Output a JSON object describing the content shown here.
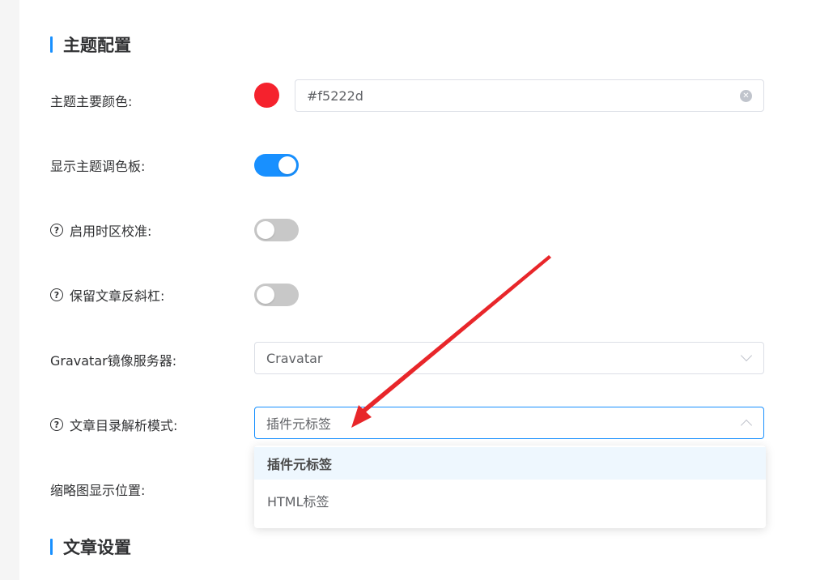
{
  "sections": {
    "theme_title": "主题配置",
    "article_title": "文章设置"
  },
  "rows": {
    "primary_color_label": "主题主要颜色:",
    "primary_color_value": "#f5222d",
    "show_palette_label": "显示主题调色板:",
    "show_palette_on": true,
    "timezone_label": "启用时区校准:",
    "timezone_on": false,
    "backslash_label": "保留文章反斜杠:",
    "backslash_on": false,
    "gravatar_label": "Gravatar镜像服务器:",
    "gravatar_value": "Cravatar",
    "toc_label": "文章目录解析模式:",
    "toc_value": "插件元标签",
    "thumbnail_label": "缩略图显示位置:"
  },
  "dropdown": {
    "options": [
      "插件元标签",
      "HTML标签"
    ],
    "selected": "插件元标签"
  },
  "icons": {
    "help": "question-circle-icon",
    "clear": "clear-icon",
    "chevron_down": "chevron-down-icon",
    "chevron_up": "chevron-up-icon"
  },
  "colors": {
    "accent": "#1890ff",
    "theme_color": "#f5222d",
    "annotation_arrow": "#e8262a"
  }
}
